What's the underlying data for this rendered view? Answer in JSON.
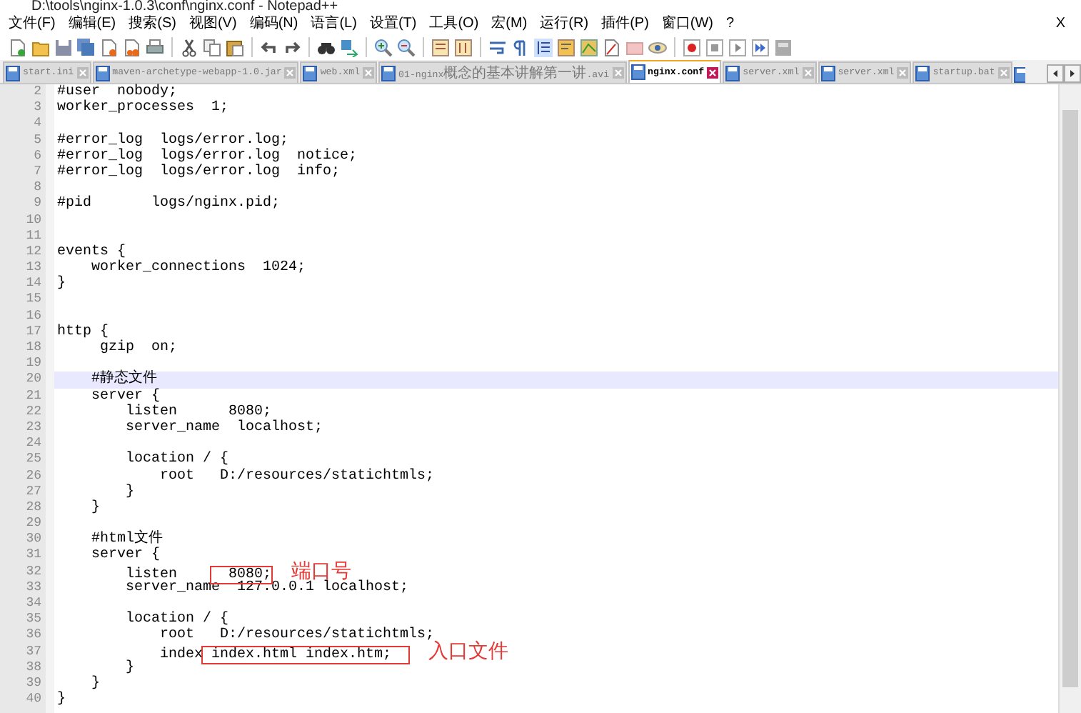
{
  "window": {
    "title": "D:\\tools\\nginx-1.0.3\\conf\\nginx.conf - Notepad++"
  },
  "menu": [
    "文件(F)",
    "编辑(E)",
    "搜索(S)",
    "视图(V)",
    "编码(N)",
    "语言(L)",
    "设置(T)",
    "工具(O)",
    "宏(M)",
    "运行(R)",
    "插件(P)",
    "窗口(W)",
    "?"
  ],
  "menu_close": "X",
  "tabs": [
    {
      "label": "start.ini",
      "selected": false
    },
    {
      "label": "maven-archetype-webapp-1.0.jar",
      "selected": false
    },
    {
      "label": "web.xml",
      "selected": false
    },
    {
      "label": "01-nginx概念的基本讲解第一讲.avi",
      "selected": false
    },
    {
      "label": "nginx.conf",
      "selected": true
    },
    {
      "label": "server.xml",
      "selected": false
    },
    {
      "label": "server.xml",
      "selected": false
    },
    {
      "label": "startup.bat",
      "selected": false
    }
  ],
  "editor": {
    "lines": [
      {
        "number": "2",
        "segments": [
          {
            "text": "#user  nobody;"
          }
        ]
      },
      {
        "number": "3",
        "segments": [
          {
            "text": "worker_processes  1;"
          }
        ]
      },
      {
        "number": "4"
      },
      {
        "number": "5",
        "segments": [
          {
            "text": "#error_log  logs/error.log;"
          }
        ]
      },
      {
        "number": "6",
        "segments": [
          {
            "text": "#error_log  logs/error.log  notice;"
          }
        ]
      },
      {
        "number": "7",
        "segments": [
          {
            "text": "#error_log  logs/error.log  info;"
          }
        ]
      },
      {
        "number": "8"
      },
      {
        "number": "9",
        "segments": [
          {
            "text": "#pid       logs/nginx.pid;"
          }
        ]
      },
      {
        "number": "10"
      },
      {
        "number": "11"
      },
      {
        "number": "12",
        "segments": [
          {
            "text": "events {"
          }
        ]
      },
      {
        "number": "13",
        "segments": [
          {
            "text": "    worker_connections  1024;"
          }
        ]
      },
      {
        "number": "14",
        "segments": [
          {
            "text": "}"
          }
        ]
      },
      {
        "number": "15"
      },
      {
        "number": "16"
      },
      {
        "number": "17",
        "segments": [
          {
            "text": "http {"
          }
        ]
      },
      {
        "number": "18",
        "segments": [
          {
            "text": "     gzip  on;"
          }
        ]
      },
      {
        "number": "19"
      },
      {
        "number": "20",
        "current": true,
        "segments": [
          {
            "text": "    #静态文件"
          }
        ]
      },
      {
        "number": "21",
        "segments": [
          {
            "text": "    server {"
          }
        ]
      },
      {
        "number": "22",
        "segments": [
          {
            "text": "        listen      8080;"
          }
        ]
      },
      {
        "number": "23",
        "segments": [
          {
            "text": "        server_name  localhost;"
          }
        ]
      },
      {
        "number": "24"
      },
      {
        "number": "25",
        "segments": [
          {
            "text": "        location / {"
          }
        ]
      },
      {
        "number": "26",
        "segments": [
          {
            "text": "            root   D:/resources/statichtmls;"
          }
        ]
      },
      {
        "number": "27",
        "segments": [
          {
            "text": "        }"
          }
        ]
      },
      {
        "number": "28",
        "segments": [
          {
            "text": "    }"
          }
        ]
      },
      {
        "number": "29"
      },
      {
        "number": "30",
        "segments": [
          {
            "text": "    #html文件"
          }
        ]
      },
      {
        "number": "31",
        "segments": [
          {
            "text": "    server {"
          }
        ]
      },
      {
        "number": "32",
        "segments": [
          {
            "text": "        listen    "
          },
          {
            "text": "  8080;",
            "kind": "boxed"
          }
        ],
        "note": "端口号"
      },
      {
        "number": "33",
        "segments": [
          {
            "text": "        server_name  127.0.0.1 localhost;"
          }
        ]
      },
      {
        "number": "34"
      },
      {
        "number": "35",
        "segments": [
          {
            "text": "        location / {"
          }
        ]
      },
      {
        "number": "36",
        "segments": [
          {
            "text": "            root   D:/resources/statichtmls;"
          }
        ]
      },
      {
        "number": "37",
        "segments": [
          {
            "text": "            index"
          },
          {
            "text": " index.html index.htm;  ",
            "kind": "boxed"
          }
        ],
        "note": "入口文件"
      },
      {
        "number": "38",
        "segments": [
          {
            "text": "        }"
          }
        ]
      },
      {
        "number": "39",
        "segments": [
          {
            "text": "    }"
          }
        ]
      },
      {
        "number": "40",
        "segments": [
          {
            "text": "}"
          }
        ]
      }
    ]
  }
}
